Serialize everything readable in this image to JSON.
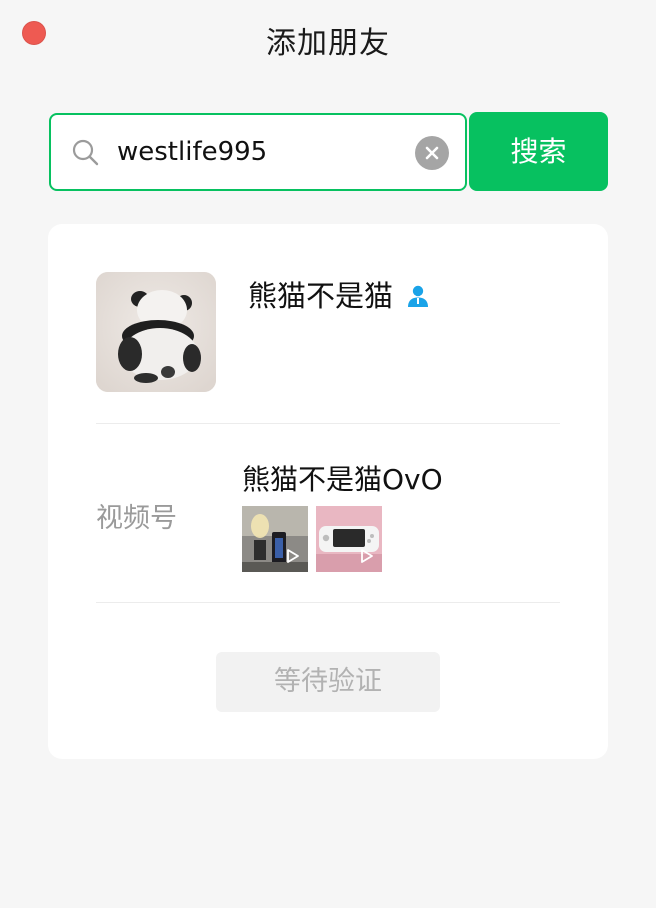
{
  "window": {
    "title": "添加朋友"
  },
  "search": {
    "value": "westlife995",
    "button_label": "搜索"
  },
  "result": {
    "nickname": "熊猫不是猫",
    "channels_label": "视频号",
    "channel_name": "熊猫不是猫OvO",
    "action_label": "等待验证"
  },
  "icons": {
    "search": "search-icon",
    "clear": "clear-icon",
    "contact": "person-icon",
    "play": "play-icon"
  },
  "colors": {
    "accent": "#07c160",
    "close_dot": "#ee5a52",
    "contact_icon": "#1aa3e8"
  }
}
